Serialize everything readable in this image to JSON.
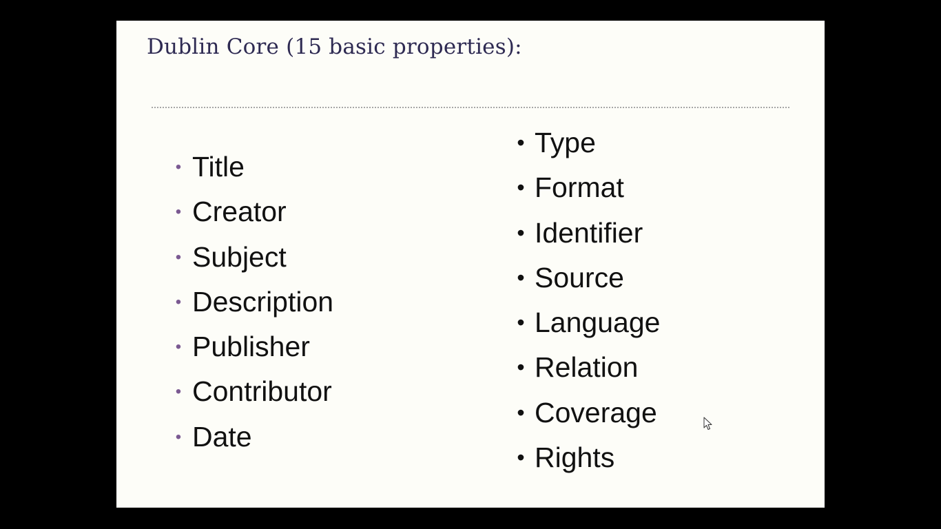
{
  "slide": {
    "title": "Dublin Core (15 basic properties):",
    "left_items": [
      {
        "label": "Title"
      },
      {
        "label": "Creator"
      },
      {
        "label": "Subject"
      },
      {
        "label": "Description"
      },
      {
        "label": "Publisher"
      },
      {
        "label": "Contributor"
      },
      {
        "label": "Date"
      }
    ],
    "right_items": [
      {
        "label": "Type"
      },
      {
        "label": "Format"
      },
      {
        "label": "Identifier"
      },
      {
        "label": "Source"
      },
      {
        "label": "Language"
      },
      {
        "label": "Relation"
      },
      {
        "label": "Coverage"
      },
      {
        "label": "Rights"
      }
    ],
    "left_bullet_color": "#7b5a92",
    "right_bullet_color": "#111111",
    "title_color": "#2e2a52",
    "background_color": "#fdfdf8"
  },
  "icons": {
    "bullet": "bullet-icon",
    "cursor": "mouse-pointer-icon"
  }
}
